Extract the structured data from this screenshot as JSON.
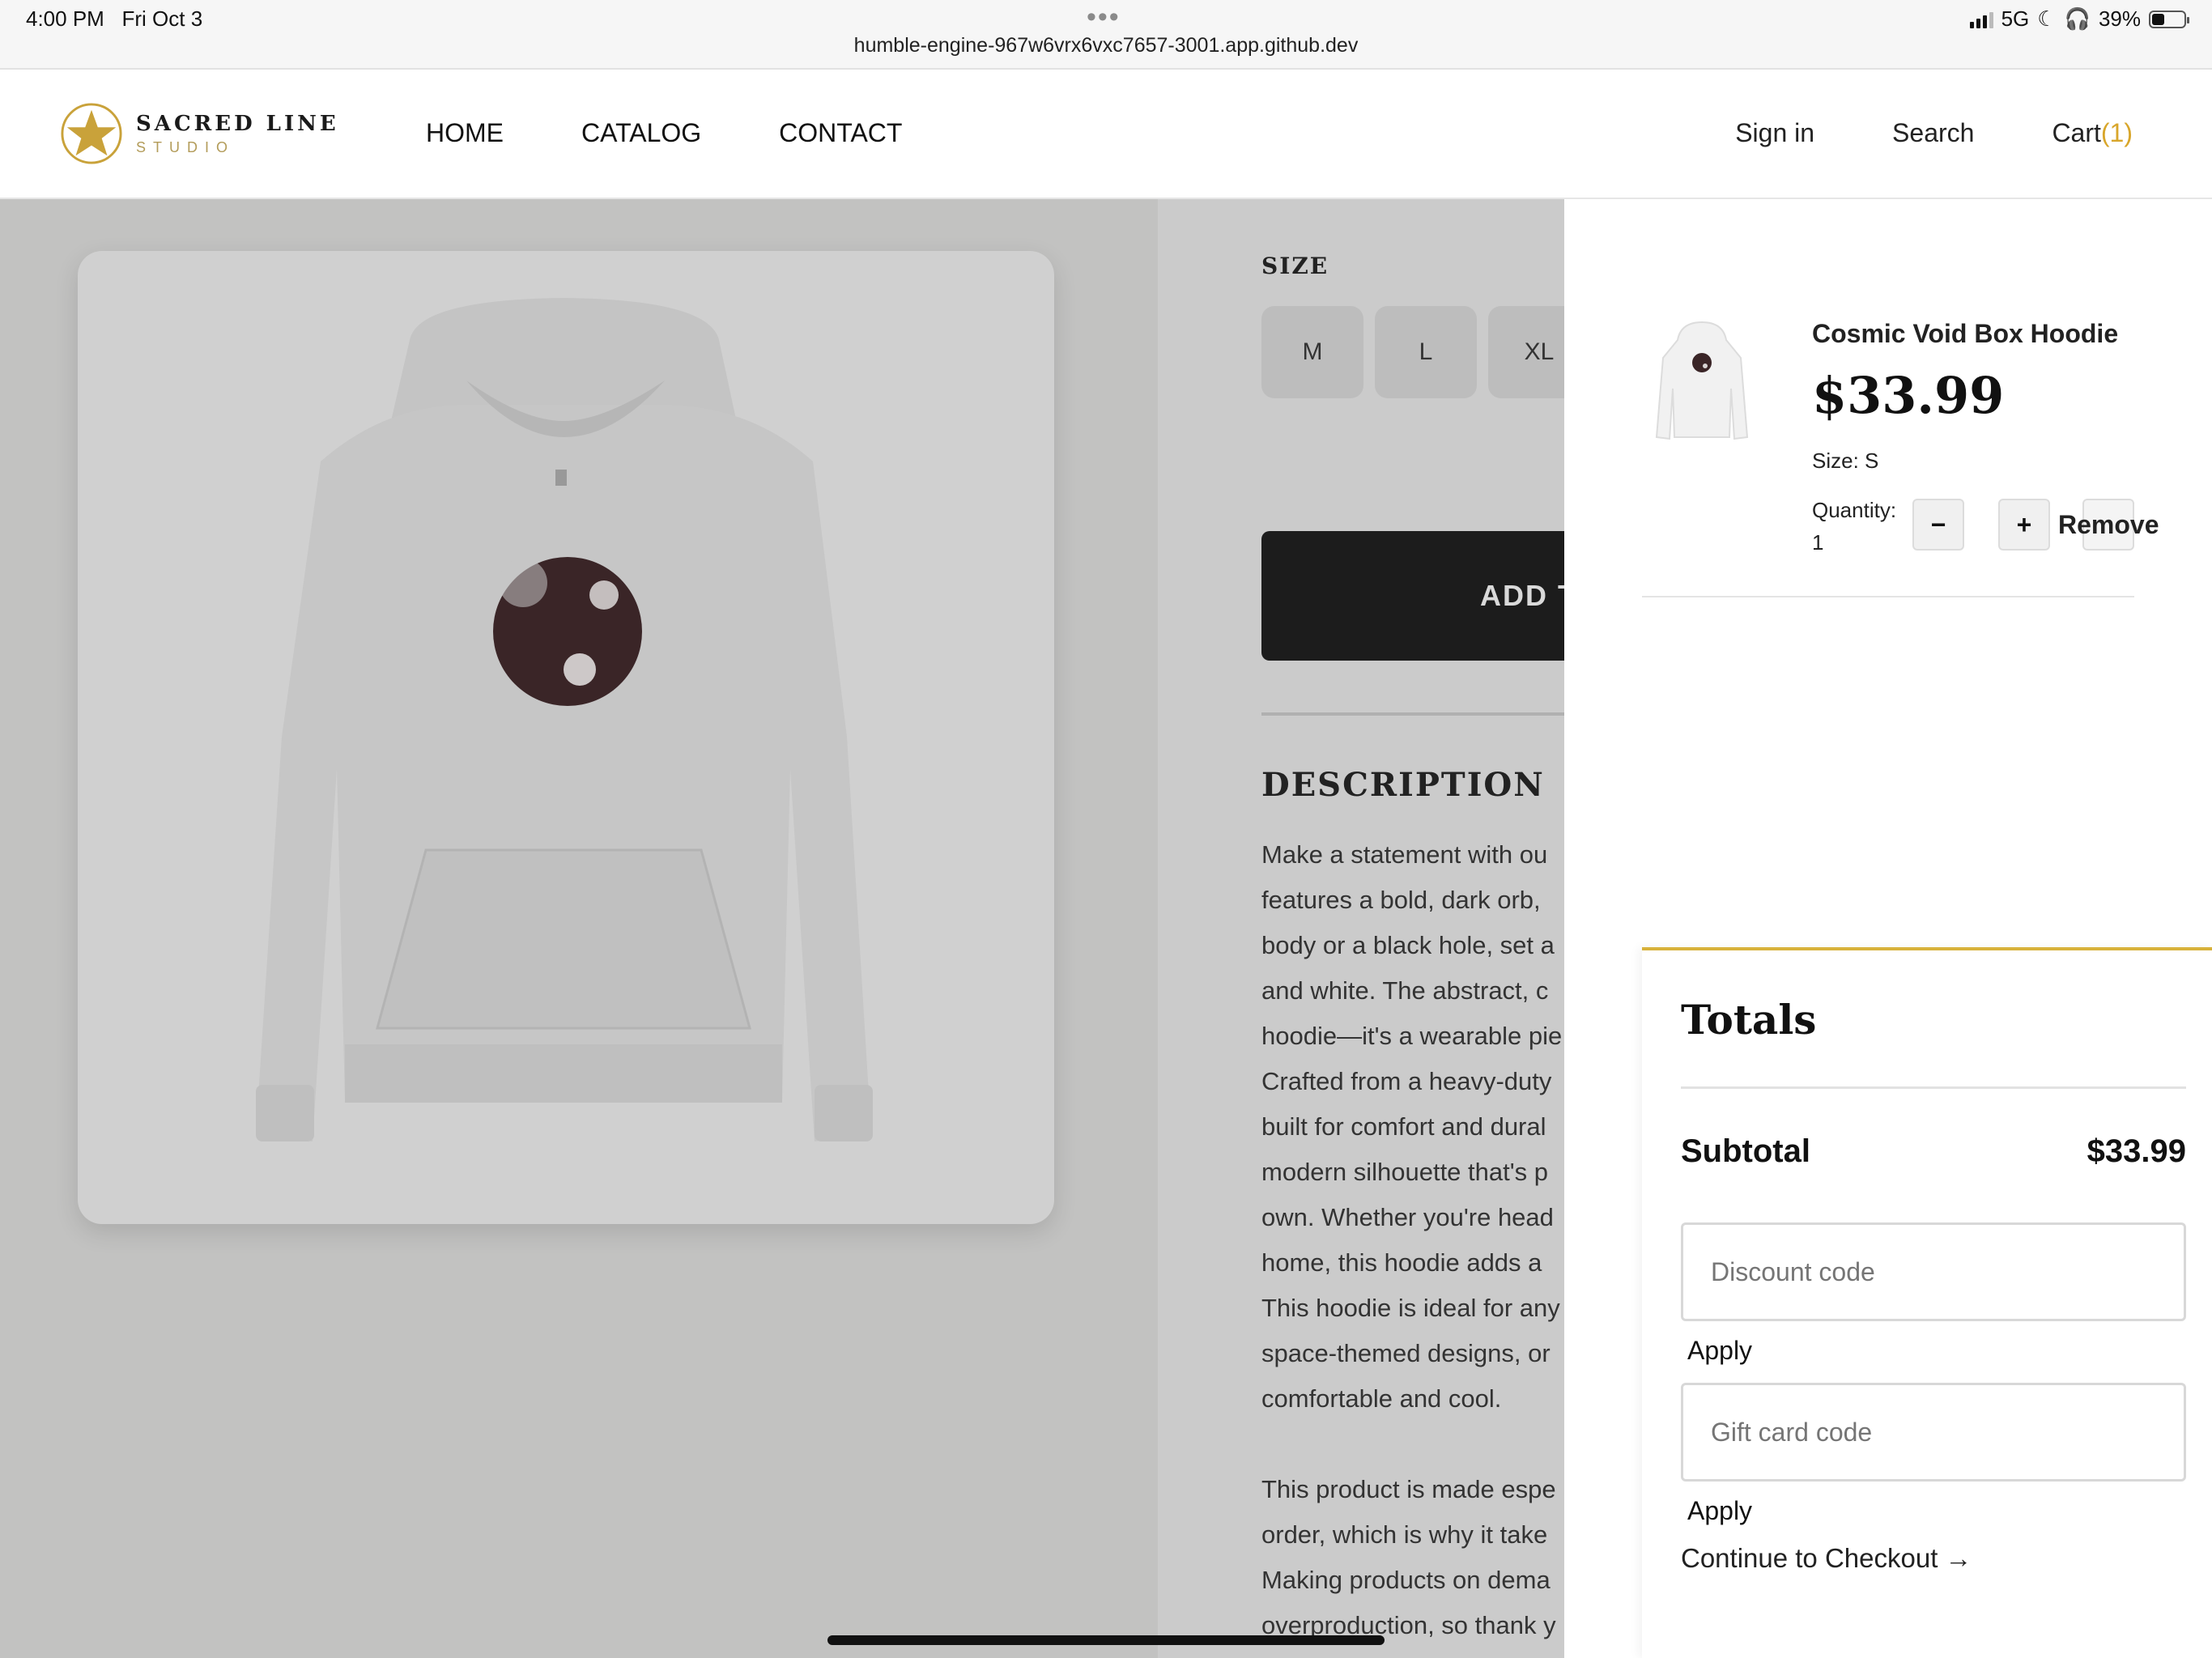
{
  "status_bar": {
    "time": "4:00 PM",
    "date": "Fri Oct 3",
    "url": "humble-engine-967w6vrx6vxc7657-3001.app.github.dev",
    "network": "5G",
    "battery": "39%",
    "battery_level": 0.39
  },
  "brand": {
    "name": "SACRED LINE",
    "sub": "STUDIO",
    "accent_color": "#d8a62b"
  },
  "nav": {
    "home": "HOME",
    "catalog": "CATALOG",
    "contact": "CONTACT"
  },
  "header_actions": {
    "sign_in": "Sign in",
    "search": "Search",
    "cart": "Cart",
    "cart_count": "(1)"
  },
  "product": {
    "size_label": "SIZE",
    "sizes": [
      "M",
      "L",
      "XL"
    ],
    "add_to_cart": "ADD T",
    "description_title": "DESCRIPTION",
    "description_lines": [
      "Make a statement with ou",
      "features a bold, dark orb,",
      "body or a black hole, set a",
      "and white. The abstract, c",
      "hoodie—it's a wearable pie",
      "Crafted from a heavy-duty",
      "built for comfort and dural",
      "modern silhouette that's p",
      "own. Whether you're head",
      "home, this hoodie adds a",
      "This hoodie is ideal for any",
      "space-themed designs, or",
      "comfortable and cool."
    ],
    "description_lines_2": [
      "This product is made espe",
      "order, which is why it take",
      "Making products on dema",
      "overproduction, so thank y"
    ]
  },
  "cart": {
    "item": {
      "name": "Cosmic Void Box Hoodie",
      "price": "$33.99",
      "size": "Size: S",
      "quantity_label": "Quantity:",
      "quantity": "1",
      "decrement": "−",
      "increment": "+",
      "remove": "Remove"
    },
    "totals": {
      "title": "Totals",
      "subtotal_label": "Subtotal",
      "subtotal_value": "$33.99",
      "discount_placeholder": "Discount code",
      "gift_placeholder": "Gift card code",
      "apply": "Apply",
      "checkout": "Continue to Checkout →"
    }
  }
}
